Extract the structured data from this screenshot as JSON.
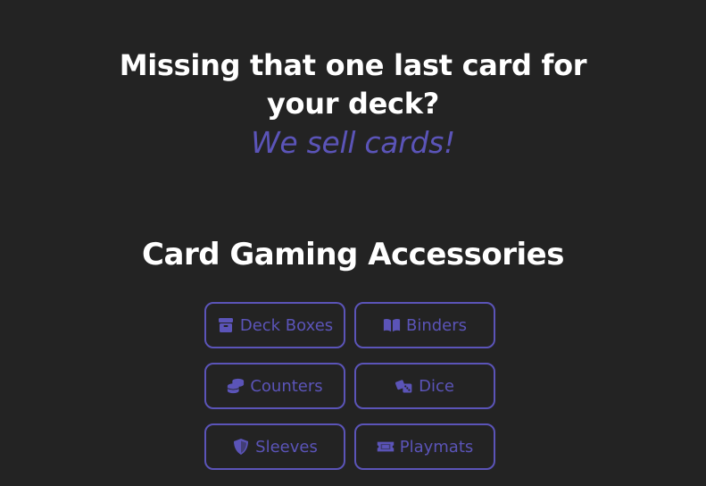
{
  "hero": {
    "title_line1": "Missing that one last card for",
    "title_line2": "your deck?",
    "tagline": "We sell cards!"
  },
  "accessories": {
    "heading": "Card Gaming Accessories",
    "items": [
      {
        "label": "Deck Boxes",
        "icon": "box-icon"
      },
      {
        "label": "Binders",
        "icon": "book-open-icon"
      },
      {
        "label": "Counters",
        "icon": "coins-icon"
      },
      {
        "label": "Dice",
        "icon": "dice-icon"
      },
      {
        "label": "Sleeves",
        "icon": "shield-icon"
      },
      {
        "label": "Playmats",
        "icon": "ticket-icon"
      }
    ]
  },
  "colors": {
    "background": "#232323",
    "accent": "#5b54b8",
    "text": "#ffffff"
  }
}
